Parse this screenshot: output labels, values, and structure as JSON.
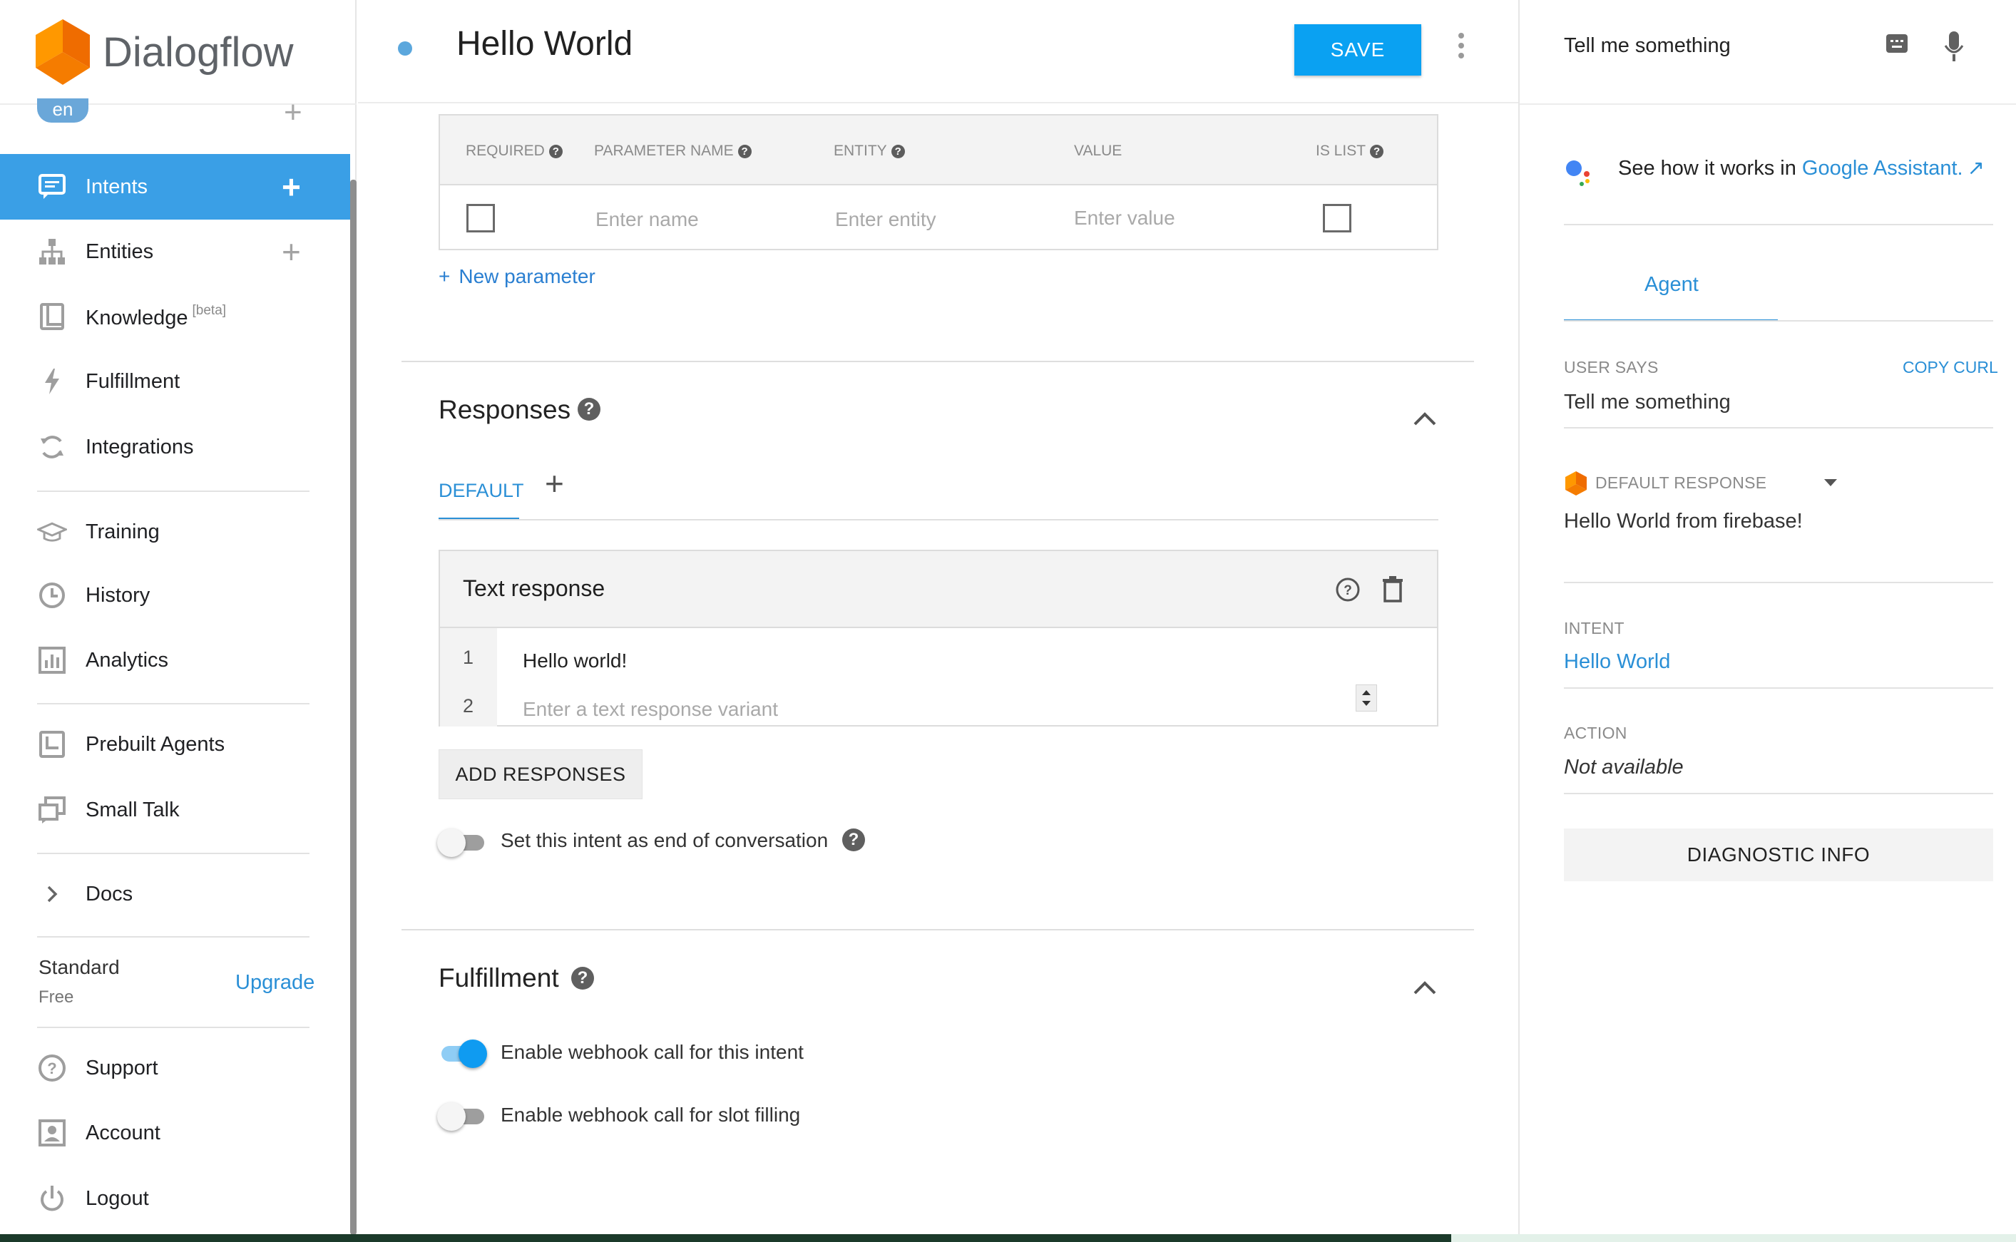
{
  "app": {
    "logo_text": "Dialogflow",
    "language": "en"
  },
  "sidebar": {
    "items": [
      {
        "label": "Intents",
        "icon": "chat-icon",
        "active": true
      },
      {
        "label": "Entities",
        "icon": "sitemap-icon"
      },
      {
        "label": "Knowledge",
        "icon": "book-icon",
        "badge": "[beta]"
      },
      {
        "label": "Fulfillment",
        "icon": "bolt-icon"
      },
      {
        "label": "Integrations",
        "icon": "sync-icon"
      },
      {
        "label": "Training",
        "icon": "graduation-cap-icon"
      },
      {
        "label": "History",
        "icon": "clock-icon"
      },
      {
        "label": "Analytics",
        "icon": "bar-chart-icon"
      },
      {
        "label": "Prebuilt Agents",
        "icon": "prebuilt-icon"
      },
      {
        "label": "Small Talk",
        "icon": "small-talk-icon"
      },
      {
        "label": "Docs",
        "icon": "chevron-right-icon"
      },
      {
        "label": "Support",
        "icon": "help-icon"
      },
      {
        "label": "Account",
        "icon": "account-icon"
      },
      {
        "label": "Logout",
        "icon": "power-icon"
      }
    ],
    "plan": {
      "name": "Standard",
      "tier": "Free",
      "upgrade_label": "Upgrade"
    }
  },
  "header": {
    "title": "Hello World",
    "save_label": "SAVE"
  },
  "parameters": {
    "columns": [
      "REQUIRED",
      "PARAMETER NAME",
      "ENTITY",
      "VALUE",
      "IS LIST"
    ],
    "row": {
      "name_placeholder": "Enter name",
      "entity_placeholder": "Enter entity",
      "value_placeholder": "Enter value",
      "required": false,
      "is_list": false
    },
    "new_parameter_label": "New parameter"
  },
  "responses": {
    "title": "Responses",
    "tab_default": "DEFAULT",
    "text_response_title": "Text response",
    "lines": [
      {
        "num": "1",
        "text": "Hello world!"
      },
      {
        "num": "2",
        "placeholder": "Enter a text response variant"
      }
    ],
    "add_responses_label": "ADD RESPONSES",
    "end_conversation_label": "Set this intent as end of conversation",
    "end_conversation_enabled": false
  },
  "fulfillment": {
    "title": "Fulfillment",
    "webhook_label": "Enable webhook call for this intent",
    "webhook_enabled": true,
    "slot_filling_label": "Enable webhook call for slot filling",
    "slot_filling_enabled": false
  },
  "test_console": {
    "input_value": "Tell me something",
    "ga_prefix": "See how it works in ",
    "ga_link": "Google Assistant.",
    "agent_tab": "Agent",
    "user_says_label": "USER SAYS",
    "copy_curl_label": "COPY CURL",
    "user_says_value": "Tell me something",
    "default_response_label": "DEFAULT RESPONSE",
    "default_response_value": "Hello World from firebase!",
    "intent_label": "INTENT",
    "intent_value": "Hello World",
    "action_label": "ACTION",
    "action_value": "Not available",
    "diagnostic_label": "DIAGNOSTIC INFO"
  },
  "colors": {
    "accent": "#3a9fe6",
    "save_button": "#0aa1f2",
    "link": "#2a8fd6"
  }
}
